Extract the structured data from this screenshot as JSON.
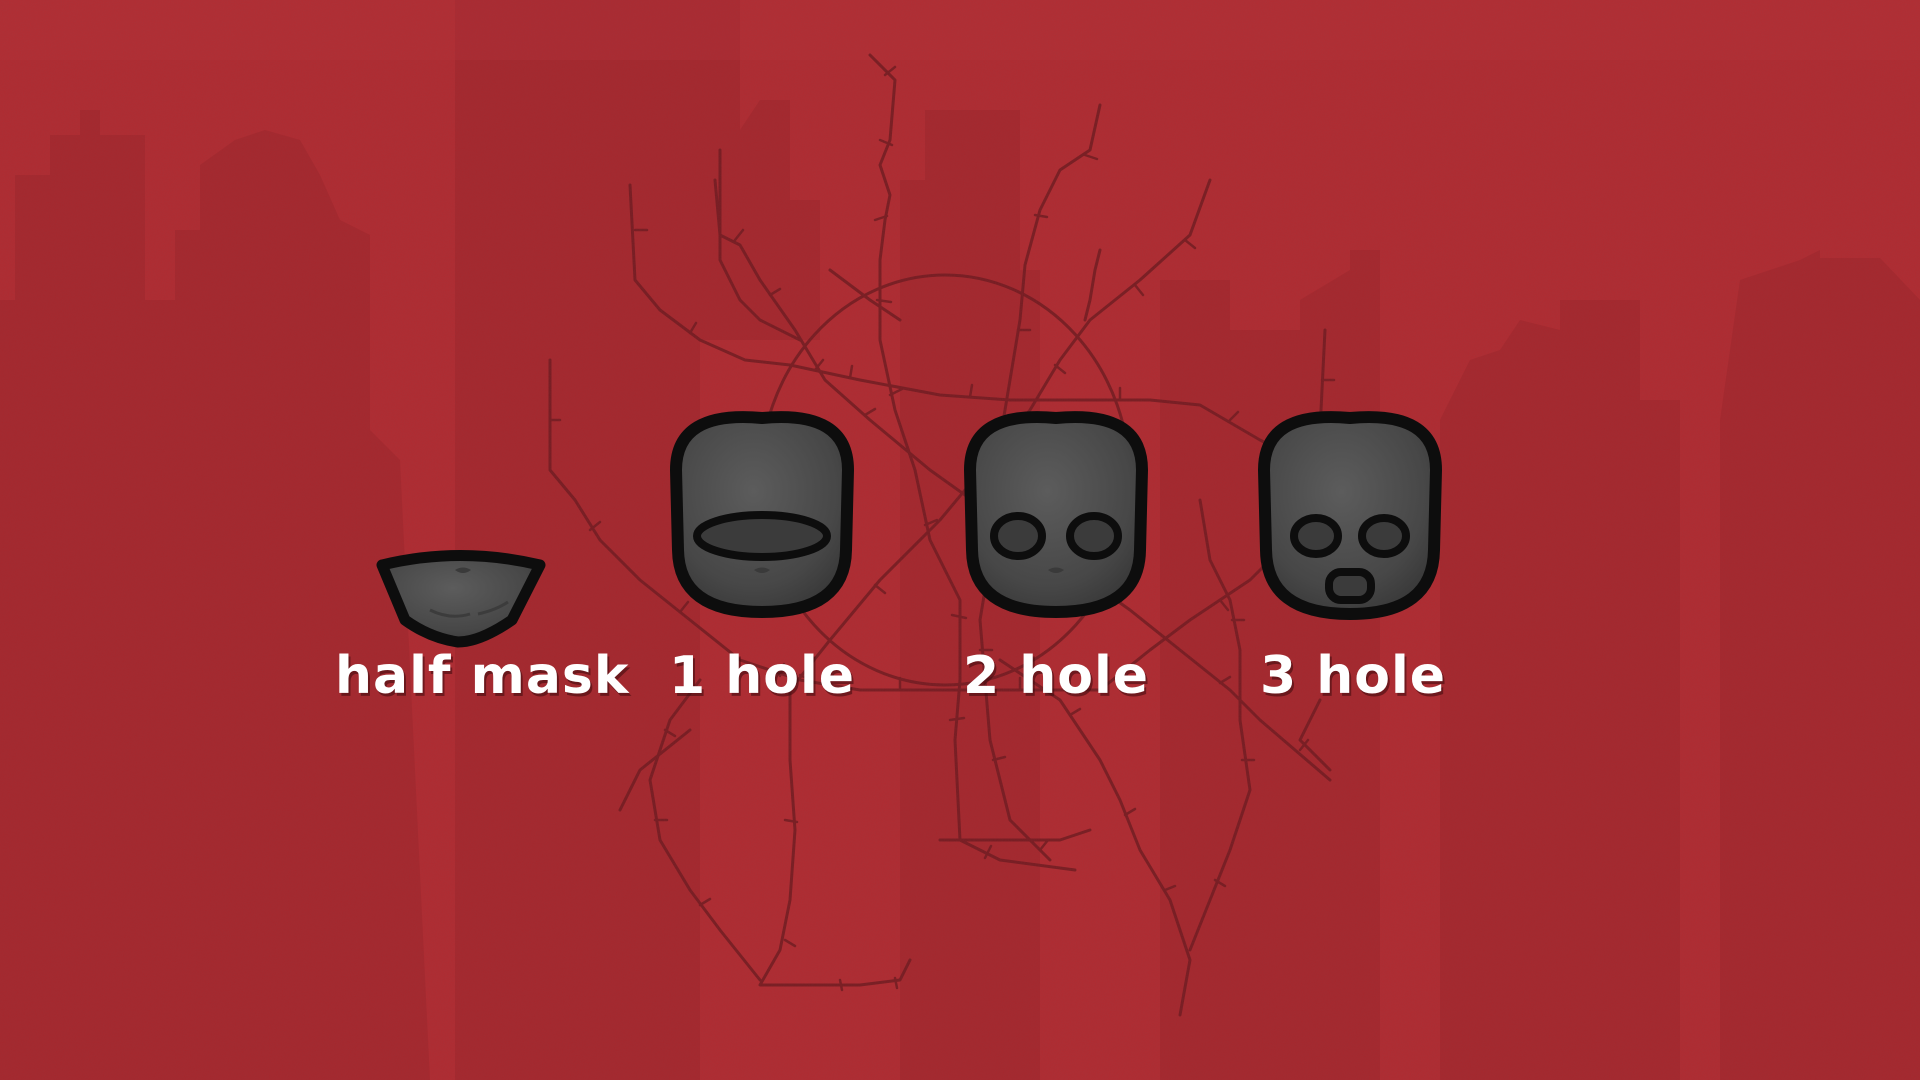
{
  "masks": [
    {
      "id": "half-mask",
      "label": "half mask",
      "holes": 0,
      "icon": "half-mask-icon"
    },
    {
      "id": "one-hole",
      "label": "1 hole",
      "holes": 1,
      "icon": "one-hole-balaclava-icon"
    },
    {
      "id": "two-hole",
      "label": "2 hole",
      "holes": 2,
      "icon": "two-hole-balaclava-icon"
    },
    {
      "id": "three-hole",
      "label": "3 hole",
      "holes": 3,
      "icon": "three-hole-balaclava-icon"
    }
  ],
  "colors": {
    "background": "#b12b31",
    "background_shadow": "#a2262c",
    "barbed_wire": "#6f1a1f",
    "mask_fill": "#4a4a4a",
    "mask_outline": "#0d0d0d",
    "caption_text": "#ffffff"
  },
  "background": {
    "texture": "grunge",
    "silhouette": "ruined city skyline",
    "overlay": "barbed wire metro map",
    "overlay_icon": "barbed-wire-map-icon"
  }
}
